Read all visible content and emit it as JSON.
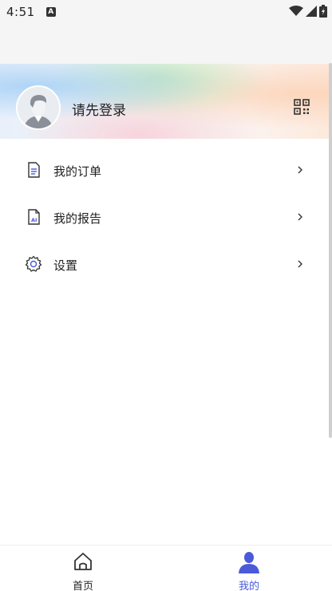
{
  "status_bar": {
    "time": "4:51",
    "notification_badge": "A"
  },
  "profile": {
    "login_prompt": "请先登录",
    "qr_icon": "qr-code-icon",
    "avatar_icon": "default-avatar"
  },
  "menu": [
    {
      "label": "我的订单",
      "icon": "order-document-icon"
    },
    {
      "label": "我的报告",
      "icon": "ai-report-icon"
    },
    {
      "label": "设置",
      "icon": "gear-icon"
    }
  ],
  "tabbar": {
    "home_label": "首页",
    "mine_label": "我的",
    "active_color": "#4a5ad8"
  }
}
